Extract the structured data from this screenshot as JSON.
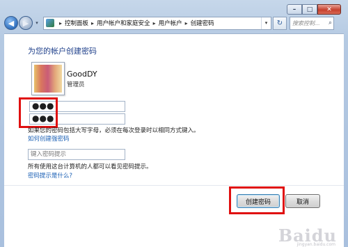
{
  "window": {
    "caption": {
      "minimize_icon": "minimize-icon",
      "maximize_icon": "maximize-icon",
      "close_icon": "close-icon"
    }
  },
  "nav": {
    "back_icon": "◀",
    "forward_icon": "▶",
    "dropdown_icon": "▾",
    "breadcrumbs": [
      "控制面板",
      "用户帐户和家庭安全",
      "用户帐户",
      "创建密码"
    ],
    "breadcrumb_sep": "▸",
    "refresh_icon": "↻",
    "search_placeholder": "搜索控制...",
    "search_icon": "⌕"
  },
  "main": {
    "title": "为您的帐户创建密码",
    "user": {
      "name": "GoodDY",
      "role": "管理员"
    },
    "password_value": "●●●",
    "confirm_value": "●●●",
    "caps_hint": "如果您的密码包括大写字母，必须在每次登录时以相同方式键入。",
    "strong_link": "如何创建强密码",
    "hint_placeholder": "键入密码提示",
    "hint_notice": "所有使用这台计算机的人都可以看见密码提示。",
    "hint_link": "密码提示是什么?",
    "create_button": "创建密码",
    "cancel_button": "取消"
  },
  "watermark": {
    "text": "Baidu",
    "sub": "jingyan.baidu.com"
  },
  "colors": {
    "title_blue": "#1e3f8a",
    "link_blue": "#1a5fb4",
    "highlight_red": "#e01010"
  }
}
